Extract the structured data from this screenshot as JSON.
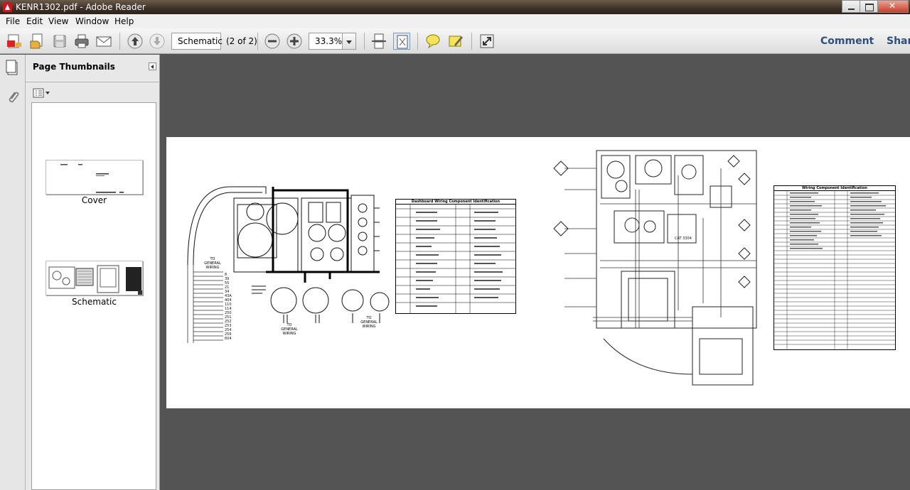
{
  "window": {
    "title": "KENR1302.pdf - Adobe Reader"
  },
  "menu": [
    "File",
    "Edit",
    "View",
    "Window",
    "Help"
  ],
  "toolbar": {
    "page_name": "Schematic",
    "page_count": "(2 of 2)",
    "zoom": "33.3%",
    "comment_label": "Comment",
    "share_label": "Share"
  },
  "panel": {
    "title": "Page Thumbnails",
    "thumbnails": [
      {
        "label": "Cover"
      },
      {
        "label": "Schematic"
      }
    ]
  },
  "document": {
    "left_table_title": "Dashboard Wiring Component Identification",
    "right_table_title": "Wiring Component Identification",
    "labels": {
      "to_general_wiring_1": "TO GENERAL WIRING",
      "to_general_wiring_2": "TO GENERAL WIRING",
      "to_general_wiring_3": "TO GENERAL WIRING",
      "cat": "CAT 3304"
    }
  },
  "colors": {
    "accent": "#2d4f7a",
    "titlebar": "#3d3026",
    "document_bg": "#545454"
  }
}
